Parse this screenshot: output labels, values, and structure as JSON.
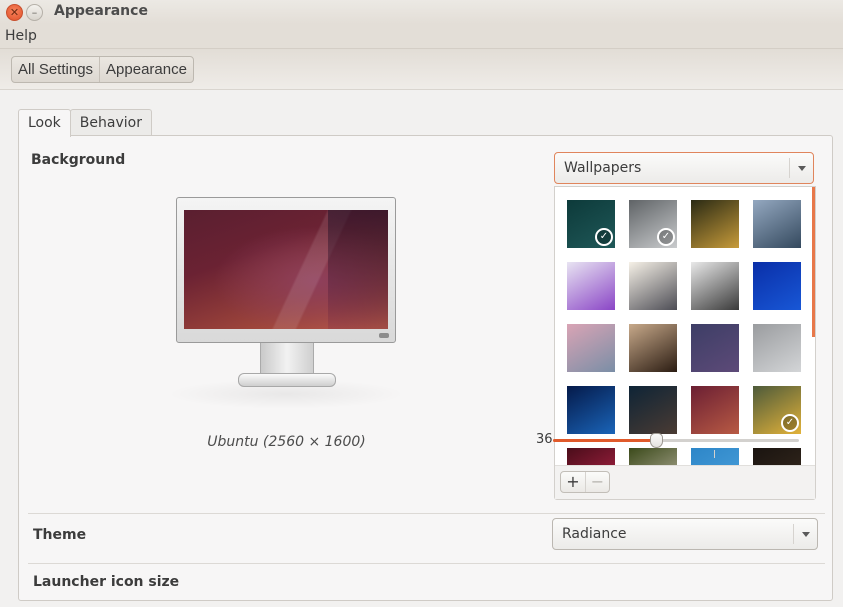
{
  "window": {
    "title": "Appearance",
    "close_icon": "close-icon",
    "minimize_icon": "minimize-icon"
  },
  "menubar": {
    "items": [
      {
        "label": "Help"
      }
    ]
  },
  "breadcrumb": [
    {
      "label": "All Settings"
    },
    {
      "label": "Appearance"
    }
  ],
  "tabs": [
    {
      "label": "Look",
      "active": true
    },
    {
      "label": "Behavior",
      "active": false
    }
  ],
  "background": {
    "label": "Background",
    "source_select": {
      "value": "Wallpapers"
    },
    "preview_caption": "Ubuntu (2560 × 1600)",
    "wallpapers": [
      {
        "name": "teal-dark",
        "colors": [
          "#0d3a3a",
          "#1f5858"
        ],
        "slideshow": true
      },
      {
        "name": "grey-sky-plane",
        "colors": [
          "#5f6366",
          "#c9cbcd"
        ],
        "slideshow": true
      },
      {
        "name": "mushrooms",
        "colors": [
          "#2a2a14",
          "#c79b3a"
        ],
        "slideshow": false
      },
      {
        "name": "sea-shore",
        "colors": [
          "#94a8c0",
          "#34495e"
        ],
        "slideshow": false
      },
      {
        "name": "purple-flowers",
        "colors": [
          "#e8e4f2",
          "#8a45c6"
        ],
        "slideshow": false
      },
      {
        "name": "foggy-hills",
        "colors": [
          "#f6f1e7",
          "#4d4d55"
        ],
        "slideshow": false
      },
      {
        "name": "grey-curve",
        "colors": [
          "#e9e9e9",
          "#3a3a3a"
        ],
        "slideshow": false
      },
      {
        "name": "jellyfish",
        "colors": [
          "#0a2fa8",
          "#1857d6"
        ],
        "slideshow": false
      },
      {
        "name": "pink-reflection",
        "colors": [
          "#d9a4b5",
          "#7a8ea6"
        ],
        "slideshow": false
      },
      {
        "name": "tunnel",
        "colors": [
          "#c7a98a",
          "#2b1c12"
        ],
        "slideshow": false
      },
      {
        "name": "night-road",
        "colors": [
          "#3d3e66",
          "#5d4a78"
        ],
        "slideshow": false
      },
      {
        "name": "plane-clouds",
        "colors": [
          "#9a9c9f",
          "#d3d5d7"
        ],
        "slideshow": false
      },
      {
        "name": "blue-particles",
        "colors": [
          "#051a4a",
          "#1a64b8"
        ],
        "slideshow": false
      },
      {
        "name": "galaxy-hill",
        "colors": [
          "#0e2436",
          "#4a3b33"
        ],
        "slideshow": false
      },
      {
        "name": "ubuntu-default",
        "colors": [
          "#6b1f33",
          "#b85a44"
        ],
        "slideshow": false
      },
      {
        "name": "yellow-flower",
        "colors": [
          "#4d5a3a",
          "#e2b23a"
        ],
        "slideshow": true
      },
      {
        "name": "red-bokeh",
        "colors": [
          "#4a0d1a",
          "#b8264a"
        ],
        "slideshow": false
      },
      {
        "name": "green-dandelion",
        "colors": [
          "#3b4a1a",
          "#c0b8a8"
        ],
        "slideshow": false
      },
      {
        "name": "blue-sky-birds",
        "colors": [
          "#2d86c8",
          "#4da2dc"
        ],
        "slideshow": false
      },
      {
        "name": "dark-wood",
        "colors": [
          "#1a1410",
          "#3a2c20"
        ],
        "slideshow": false
      }
    ],
    "add_button": "+",
    "remove_button": "−"
  },
  "theme": {
    "label": "Theme",
    "value": "Radiance"
  },
  "launcher": {
    "label": "Launcher icon size",
    "value": "36",
    "value_num": 36,
    "min": 16,
    "max": 64
  },
  "colors": {
    "accent": "#e05a2b",
    "focus_border": "#e0855c"
  }
}
